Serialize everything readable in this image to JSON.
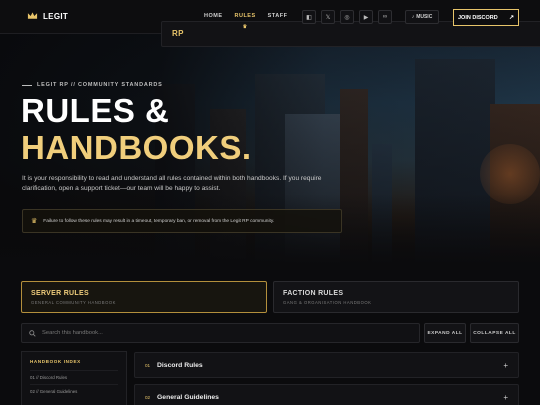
{
  "brand": {
    "name_main": "LEGIT",
    "name_accent": "RP"
  },
  "nav": {
    "links": [
      {
        "label": "HOME"
      },
      {
        "label": "RULES"
      },
      {
        "label": "STAFF"
      }
    ],
    "socials": [
      "discord-icon",
      "x-icon",
      "instagram-icon",
      "youtube-icon",
      "link-icon"
    ],
    "music_label": "MUSIC",
    "join_label": "JOIN DISCORD"
  },
  "hero": {
    "eyebrow": "LEGIT RP // COMMUNITY STANDARDS",
    "title_line1": "RULES &",
    "title_line2": "HANDBOOKS.",
    "intro": "It is your responsibility to read and understand all rules contained within both handbooks. If you require clarification, open a support ticket—our team will be happy to assist.",
    "warning": "Failure to follow these rules may result in a timeout, temporary ban, or removal from the Legit RP community."
  },
  "tabs": [
    {
      "title": "SERVER RULES",
      "subtitle": "GENERAL COMMUNITY HANDBOOK"
    },
    {
      "title": "FACTION RULES",
      "subtitle": "GANG & ORGANISATION HANDBOOK"
    }
  ],
  "search": {
    "placeholder": "Search this handbook..."
  },
  "actions": {
    "expand": "EXPAND ALL",
    "collapse": "COLLAPSE ALL"
  },
  "index": {
    "title": "HANDBOOK INDEX",
    "items": [
      "01 // Discord Rules",
      "02 // General Guidelines"
    ]
  },
  "sections": [
    {
      "num": "01",
      "title": "Discord Rules"
    },
    {
      "num": "02",
      "title": "General Guidelines"
    }
  ],
  "colors": {
    "accent": "#e7c46a",
    "background": "#0b0b0d"
  }
}
